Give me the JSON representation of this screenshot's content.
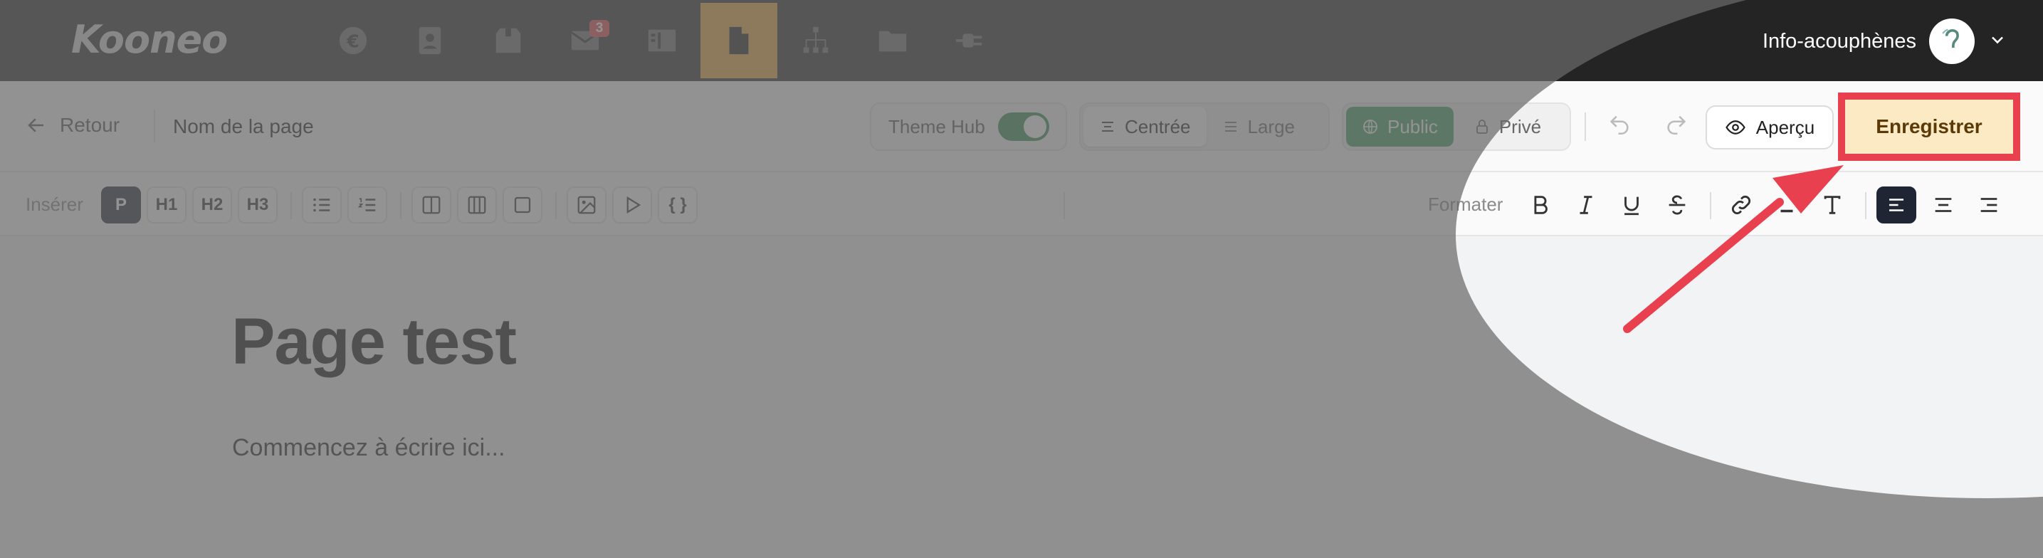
{
  "app": {
    "logo": "Kooneo"
  },
  "nav": {
    "items": [
      {
        "icon": "euro-icon"
      },
      {
        "icon": "contacts-icon"
      },
      {
        "icon": "box-icon"
      },
      {
        "icon": "mail-icon",
        "badge": "3"
      },
      {
        "icon": "columns-icon"
      },
      {
        "icon": "page-icon",
        "active": true
      },
      {
        "icon": "sitemap-icon"
      },
      {
        "icon": "folder-icon"
      },
      {
        "icon": "plug-icon"
      }
    ],
    "account_name": "Info-acouphènes"
  },
  "header": {
    "back_label": "Retour",
    "page_name": "Nom de la page",
    "theme_hub_label": "Theme Hub",
    "theme_hub_on": true,
    "layout_centered": "Centrée",
    "layout_wide": "Large",
    "visibility_public": "Public",
    "visibility_private": "Privé",
    "preview_label": "Aperçu",
    "save_label": "Enregistrer"
  },
  "toolbar": {
    "insert_label": "Insérer",
    "p": "P",
    "h1": "H1",
    "h2": "H2",
    "h3": "H3",
    "code": "{ }",
    "format_label": "Formater"
  },
  "content": {
    "title": "Page test",
    "placeholder": "Commencez à écrire ici..."
  },
  "colors": {
    "active_nav": "#eaa63c",
    "public_green": "#3f9a5e",
    "save_highlight": "#e8404e",
    "save_bg": "#fbeac3"
  }
}
